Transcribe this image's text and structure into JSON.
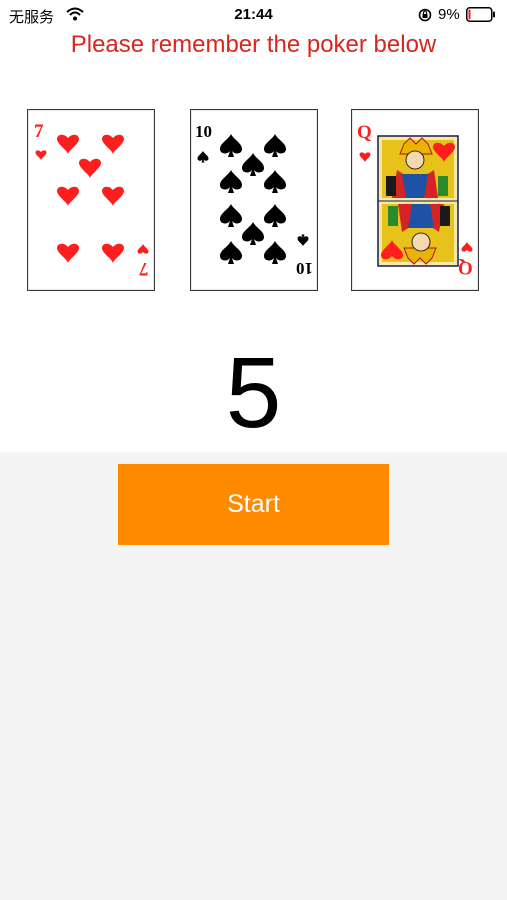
{
  "status_bar": {
    "carrier": "无服务",
    "time": "21:44",
    "battery_percent": "9%",
    "battery_level": 0.09
  },
  "instruction": "Please remember the poker below",
  "cards": [
    {
      "rank": "7",
      "suit": "hearts",
      "color": "#ff1e1e"
    },
    {
      "rank": "10",
      "suit": "spades",
      "color": "#000000"
    },
    {
      "rank": "Q",
      "suit": "hearts",
      "color": "#ff1e1e"
    }
  ],
  "countdown": "5",
  "start_button": {
    "label": "Start",
    "color": "#ff8a00"
  },
  "colors": {
    "instruction": "#d8261f",
    "background": "#f4f4f4"
  }
}
